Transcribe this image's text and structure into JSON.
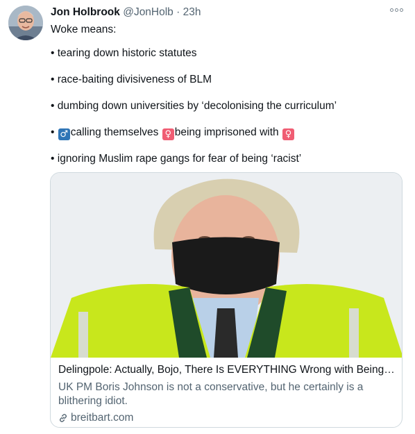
{
  "tweet": {
    "author_name": "Jon Holbrook",
    "author_handle": "@JonHolb",
    "separator": "·",
    "time": "23h",
    "more_icon": "more-options-icon",
    "text": {
      "intro": "Woke means:",
      "bullet": "•",
      "item1": "tearing down historic statutes",
      "item2": "race-baiting divisiveness of BLM",
      "item3": "dumbing down universities by ‘decolonising the curriculum’",
      "item4_symbol_male": "♂",
      "item4_part1": "calling themselves",
      "item4_symbol_female_1": "♀",
      "item4_part2": "being imprisoned with",
      "item4_symbol_female_2": "♀",
      "item5": "ignoring Muslim rape gangs for fear of being ‘racist’"
    },
    "link_card": {
      "title": "Delingpole: Actually, Bojo, There Is EVERYTHING Wrong with Being W...",
      "description": "UK PM Boris Johnson is not a conservative, but he certainly is a blithering idiot.",
      "domain": "breitbart.com",
      "link_icon": "link-icon"
    }
  },
  "colors": {
    "text_primary": "#0f1419",
    "text_secondary": "#536471",
    "border": "#cfd9de",
    "male_symbol_bg": "#2f75b6",
    "female_symbol_bg": "#f05d73",
    "hi_vis_jacket": "#c8e71c"
  }
}
